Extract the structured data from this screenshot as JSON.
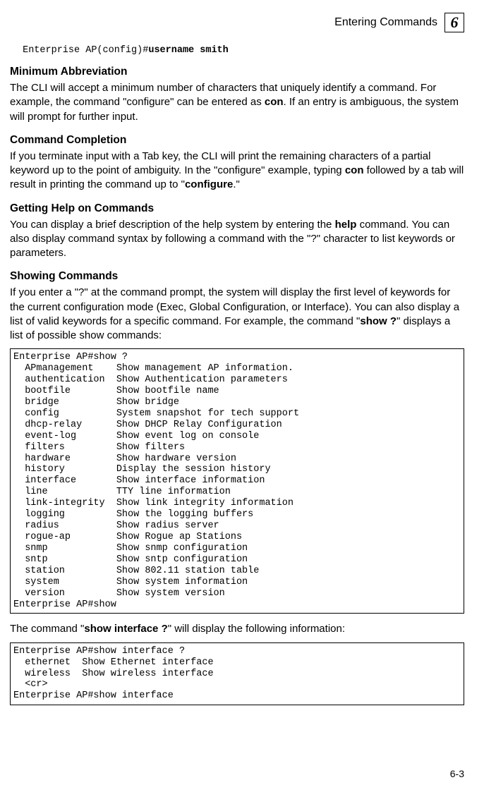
{
  "header": {
    "title": "Entering Commands",
    "chapter": "6"
  },
  "cmd1": {
    "prompt": " Enterprise AP(config)#",
    "command": "username smith"
  },
  "section1": {
    "heading": "Minimum Abbreviation",
    "p1_a": "The CLI will accept a minimum number of characters that uniquely identify a command. For example, the command \"configure\" can be entered as ",
    "p1_bold": "con",
    "p1_b": ". If an entry is ambiguous, the system will prompt for further input."
  },
  "section2": {
    "heading": "Command Completion",
    "p1_a": "If you terminate input with a Tab key, the CLI will print the remaining characters of a partial keyword up to the point of ambiguity. In the \"configure\" example, typing ",
    "p1_bold1": "con",
    "p1_b": " followed by a tab will result in printing the command up to \"",
    "p1_bold2": "configure",
    "p1_c": ".\""
  },
  "section3": {
    "heading": "Getting Help on Commands",
    "p1_a": "You can display a brief description of the help system by entering the ",
    "p1_bold": "help",
    "p1_b": " command. You can also display command syntax by following a command with the \"?\" character to list keywords or parameters."
  },
  "section4": {
    "heading": "Showing Commands",
    "p1_a": "If you enter a \"?\" at the command prompt, the system will display the first level of keywords for the current configuration mode (Exec, Global Configuration, or Interface). You can also display a list of valid keywords for a specific command. For example, the command \"",
    "p1_bold": "show ?",
    "p1_b": "\" displays a list of possible show commands:"
  },
  "codeblock1": "Enterprise AP#show ?\n  APmanagement    Show management AP information.\n  authentication  Show Authentication parameters\n  bootfile        Show bootfile name\n  bridge          Show bridge\n  config          System snapshot for tech support\n  dhcp-relay      Show DHCP Relay Configuration\n  event-log       Show event log on console\n  filters         Show filters\n  hardware        Show hardware version\n  history         Display the session history\n  interface       Show interface information\n  line            TTY line information\n  link-integrity  Show link integrity information\n  logging         Show the logging buffers\n  radius          Show radius server\n  rogue-ap        Show Rogue ap Stations\n  snmp            Show snmp configuration\n  sntp            Show sntp configuration\n  station         Show 802.11 station table\n  system          Show system information\n  version         Show system version\nEnterprise AP#show",
  "section5": {
    "p1_a": "The command \"",
    "p1_bold": "show interface ?",
    "p1_b": "\" will display the following information:"
  },
  "codeblock2": "Enterprise AP#show interface ?\n  ethernet  Show Ethernet interface\n  wireless  Show wireless interface\n  <cr>\nEnterprise AP#show interface",
  "footer": "6-3"
}
